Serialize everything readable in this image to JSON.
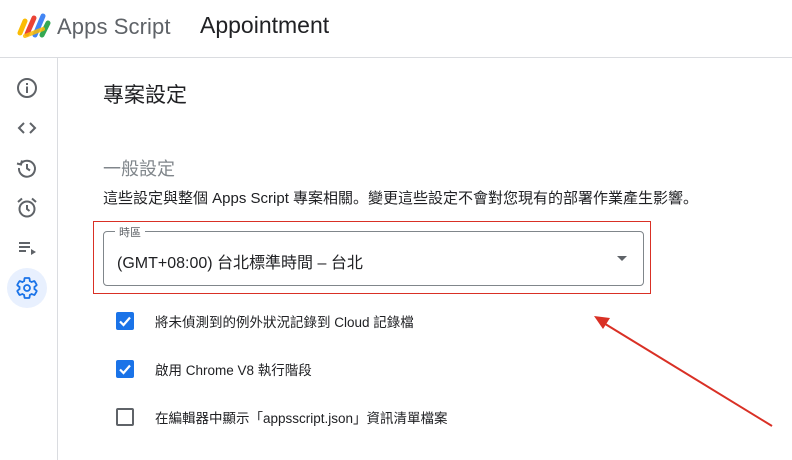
{
  "header": {
    "app_name": "Apps Script",
    "project_title": "Appointment"
  },
  "sidebar": {
    "items": [
      {
        "name": "overview",
        "icon": "info-icon",
        "active": false
      },
      {
        "name": "editor",
        "icon": "code-icon",
        "active": false
      },
      {
        "name": "executions",
        "icon": "history-icon",
        "active": false
      },
      {
        "name": "triggers",
        "icon": "alarm-icon",
        "active": false
      },
      {
        "name": "executions-list",
        "icon": "playlist-play-icon",
        "active": false
      },
      {
        "name": "project-settings",
        "icon": "gear-icon",
        "active": true
      }
    ]
  },
  "main": {
    "page_title": "專案設定",
    "section_title": "一般設定",
    "section_description": "這些設定與整個 Apps Script 專案相關。變更這些設定不會對您現有的部署作業產生影響。",
    "timezone": {
      "label": "時區",
      "value": "(GMT+08:00) 台北標準時間 – 台北"
    },
    "options": [
      {
        "label": "將未偵測到的例外狀況記錄到 Cloud 記錄檔",
        "checked": true
      },
      {
        "label": "啟用 Chrome V8 執行階段",
        "checked": true
      },
      {
        "label": "在編輯器中顯示「appsscript.json」資訊清單檔案",
        "checked": false
      }
    ]
  },
  "colors": {
    "accent": "#1a73e8",
    "active_bg": "#e8f0fe",
    "annotation": "#d93025",
    "divider": "#dadce0"
  }
}
